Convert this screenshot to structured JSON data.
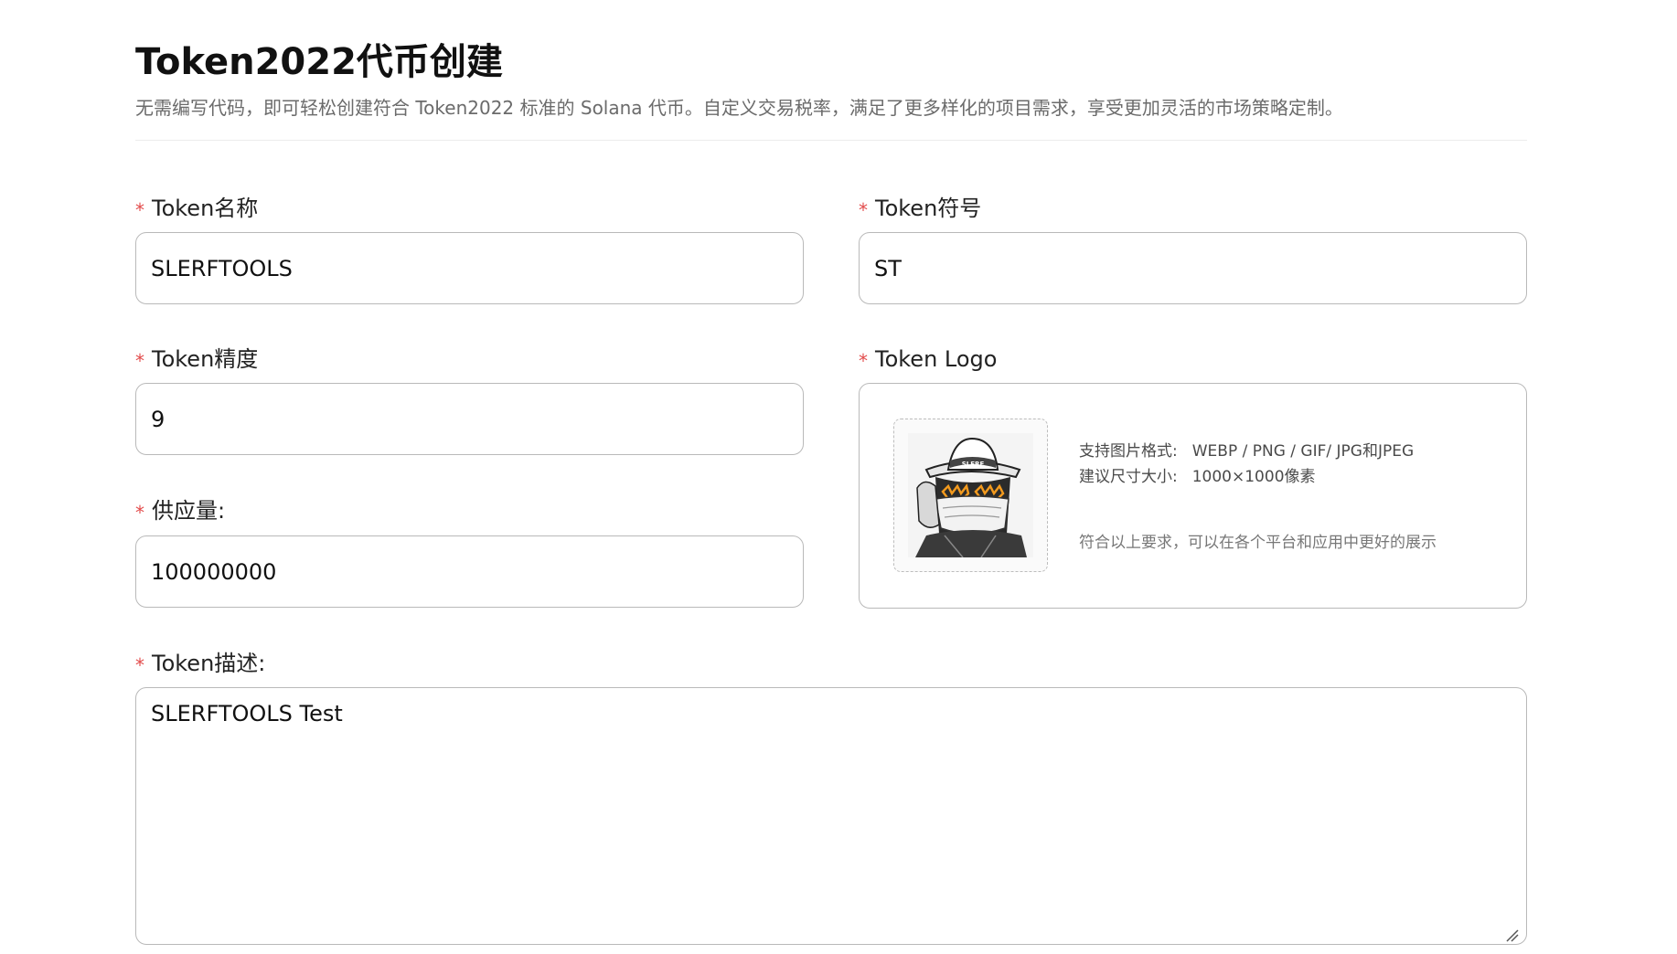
{
  "header": {
    "title": "Token2022代币创建",
    "subtitle": "无需编写代码，即可轻松创建符合 Token2022 标准的 Solana 代币。自定义交易税率，满足了更多样化的项目需求，享受更加灵活的市场策略定制。"
  },
  "form": {
    "required_mark": "*",
    "token_name": {
      "label": "Token名称",
      "value": "SLERFTOOLS"
    },
    "token_symbol": {
      "label": "Token符号",
      "value": "ST"
    },
    "token_decimals": {
      "label": "Token精度",
      "value": "9"
    },
    "supply": {
      "label": "供应量:",
      "value": "100000000"
    },
    "token_logo": {
      "label": "Token Logo",
      "format_key": "支持图片格式:",
      "format_value": "WEBP / PNG / GIF/ JPG和JPEG",
      "size_key": "建议尺寸大小:",
      "size_value": "1000×1000像素",
      "hint": "符合以上要求，可以在各个平台和应用中更好的展示",
      "image_text": "SLERF"
    },
    "description": {
      "label": "Token描述:",
      "value": "SLERFTOOLS Test"
    }
  },
  "colors": {
    "required": "#e24b4b",
    "border": "#b9b9b9",
    "muted_text": "#6b6b6b",
    "logo_accent": "#f29a1e"
  }
}
